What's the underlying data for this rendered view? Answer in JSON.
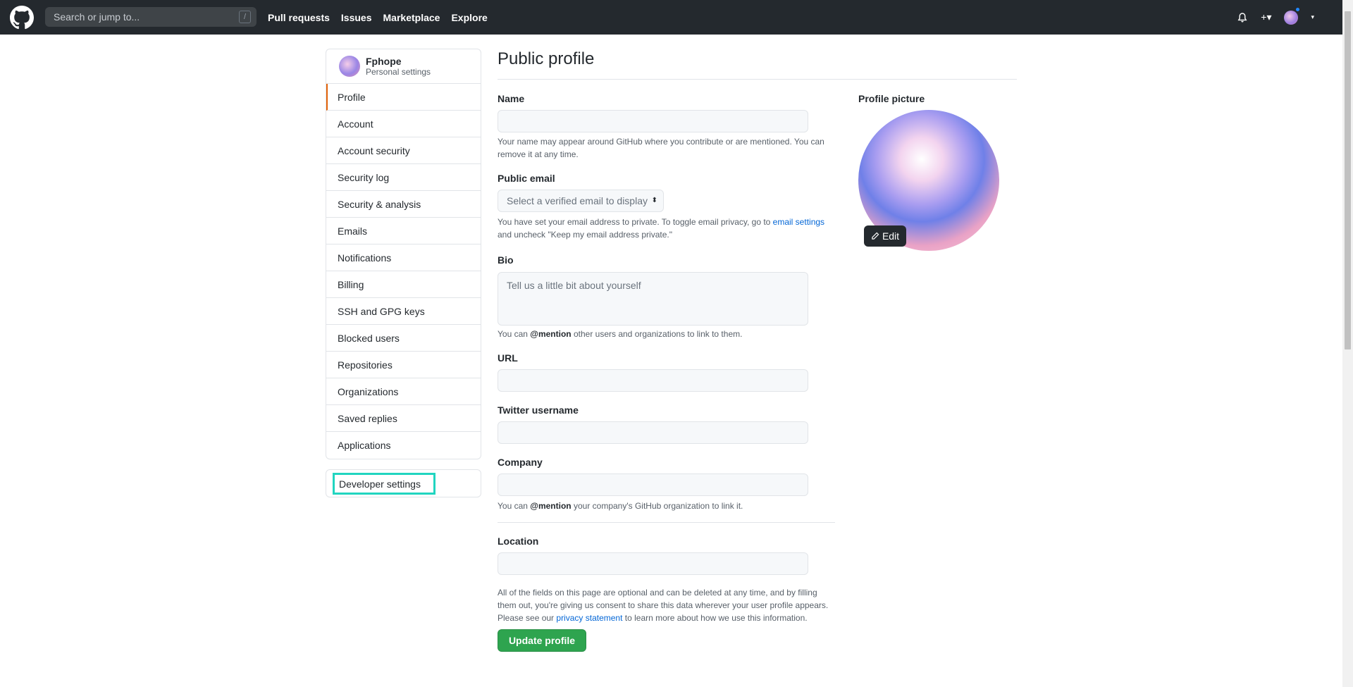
{
  "header": {
    "search_placeholder": "Search or jump to...",
    "slash_key": "/",
    "nav": [
      "Pull requests",
      "Issues",
      "Marketplace",
      "Explore"
    ],
    "plus_label": "+▾"
  },
  "sidebar": {
    "user_name": "Fphope",
    "user_sub": "Personal settings",
    "items": [
      "Profile",
      "Account",
      "Account security",
      "Security log",
      "Security & analysis",
      "Emails",
      "Notifications",
      "Billing",
      "SSH and GPG keys",
      "Blocked users",
      "Repositories",
      "Organizations",
      "Saved replies",
      "Applications"
    ],
    "developer_settings": "Developer settings"
  },
  "main": {
    "title": "Public profile",
    "name_label": "Name",
    "name_note": "Your name may appear around GitHub where you contribute or are mentioned. You can remove it at any time.",
    "email_label": "Public email",
    "email_select": "Select a verified email to display",
    "email_note_pre": "You have set your email address to private. To toggle email privacy, go to ",
    "email_note_link": "email settings",
    "email_note_post": " and uncheck \"Keep my email address private.\"",
    "bio_label": "Bio",
    "bio_placeholder": "Tell us a little bit about yourself",
    "bio_note_pre": "You can ",
    "bio_note_mention": "@mention",
    "bio_note_post": " other users and organizations to link to them.",
    "url_label": "URL",
    "twitter_label": "Twitter username",
    "company_label": "Company",
    "company_note_pre": "You can ",
    "company_note_mention": "@mention",
    "company_note_post": " your company's GitHub organization to link it.",
    "location_label": "Location",
    "footer_note_pre": "All of the fields on this page are optional and can be deleted at any time, and by filling them out, you're giving us consent to share this data wherever your user profile appears. Please see our ",
    "footer_note_link": "privacy statement",
    "footer_note_post": " to learn more about how we use this information.",
    "update_button": "Update profile"
  },
  "picture": {
    "label": "Profile picture",
    "edit_button": "Edit"
  },
  "colors": {
    "header_bg": "#24292e",
    "accent_active": "#e36209",
    "primary_button": "#2ea44f",
    "highlight_box": "#21d5c0",
    "link": "#0366d6"
  }
}
